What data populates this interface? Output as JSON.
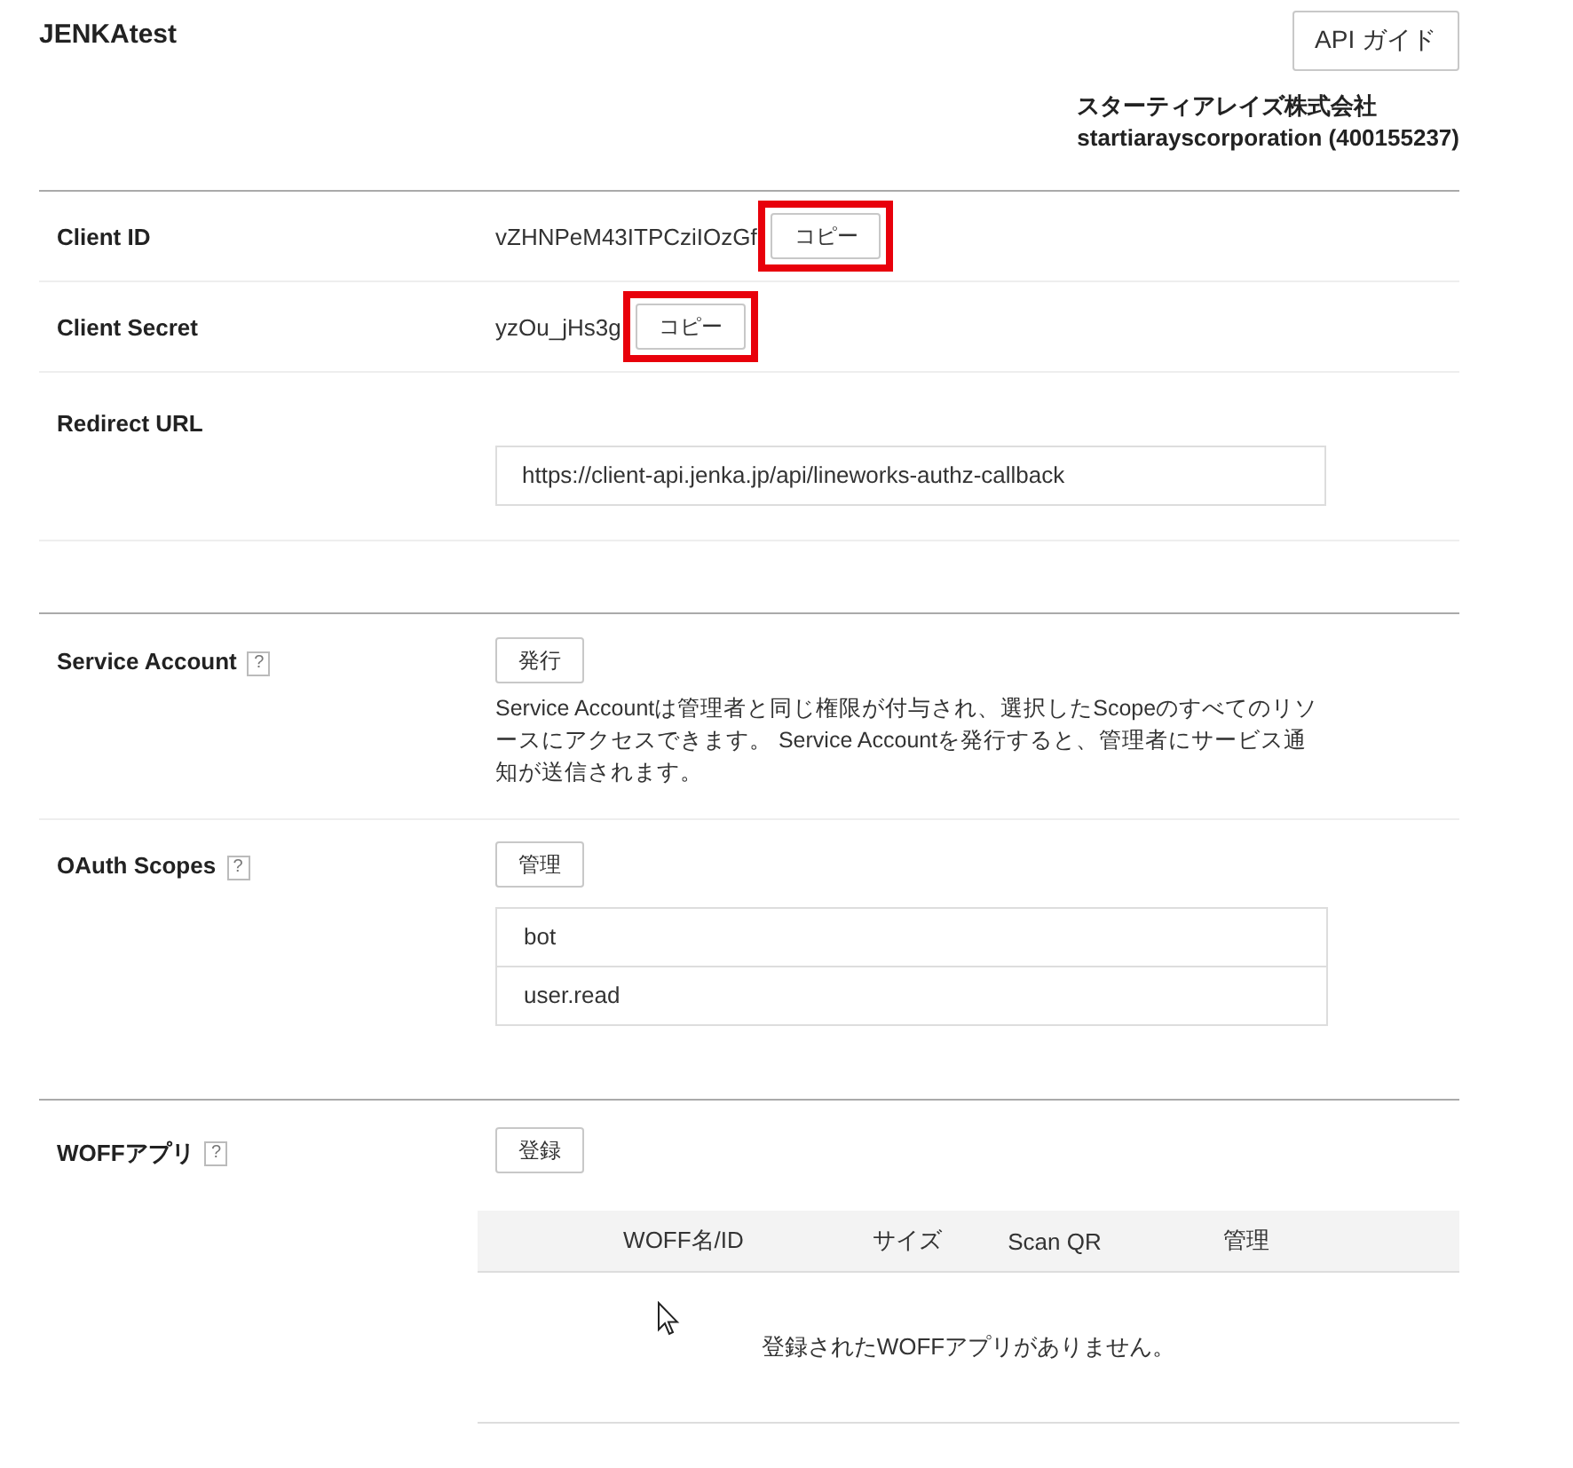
{
  "app_name": "JENKAtest",
  "guide_button": "API ガイド",
  "company": {
    "name": "スターティアレイズ株式会社",
    "account": "startiarayscorporation (400155237)"
  },
  "credentials": [
    {
      "label": "Client ID",
      "value": "vZHNPeM43ITPCziIOzGf",
      "button": "コピー",
      "highlighted": true
    },
    {
      "label": "Client Secret",
      "value": "yzOu_jHs3g",
      "button": "コピー",
      "highlighted": true
    }
  ],
  "redirect": {
    "label": "Redirect URL",
    "value": "https://client-api.jenka.jp/api/lineworks-authz-callback"
  },
  "service_account": {
    "label": "Service Account",
    "help": "?",
    "button": "発行",
    "description": "Service Accountは管理者と同じ権限が付与され、選択したScopeのすべてのリソースにアクセスできます。 Service Accountを発行すると、管理者にサービス通知が送信されます。"
  },
  "oauth_scopes": {
    "label": "OAuth Scopes",
    "help": "?",
    "button": "管理",
    "scopes": [
      "bot",
      "user.read"
    ]
  },
  "woff": {
    "label": "WOFFアプリ",
    "help": "?",
    "button": "登録",
    "columns": [
      "WOFF名/ID",
      "サイズ",
      "Scan QR",
      "管理"
    ],
    "empty_message": "登録されたWOFFアプリがありません。"
  }
}
